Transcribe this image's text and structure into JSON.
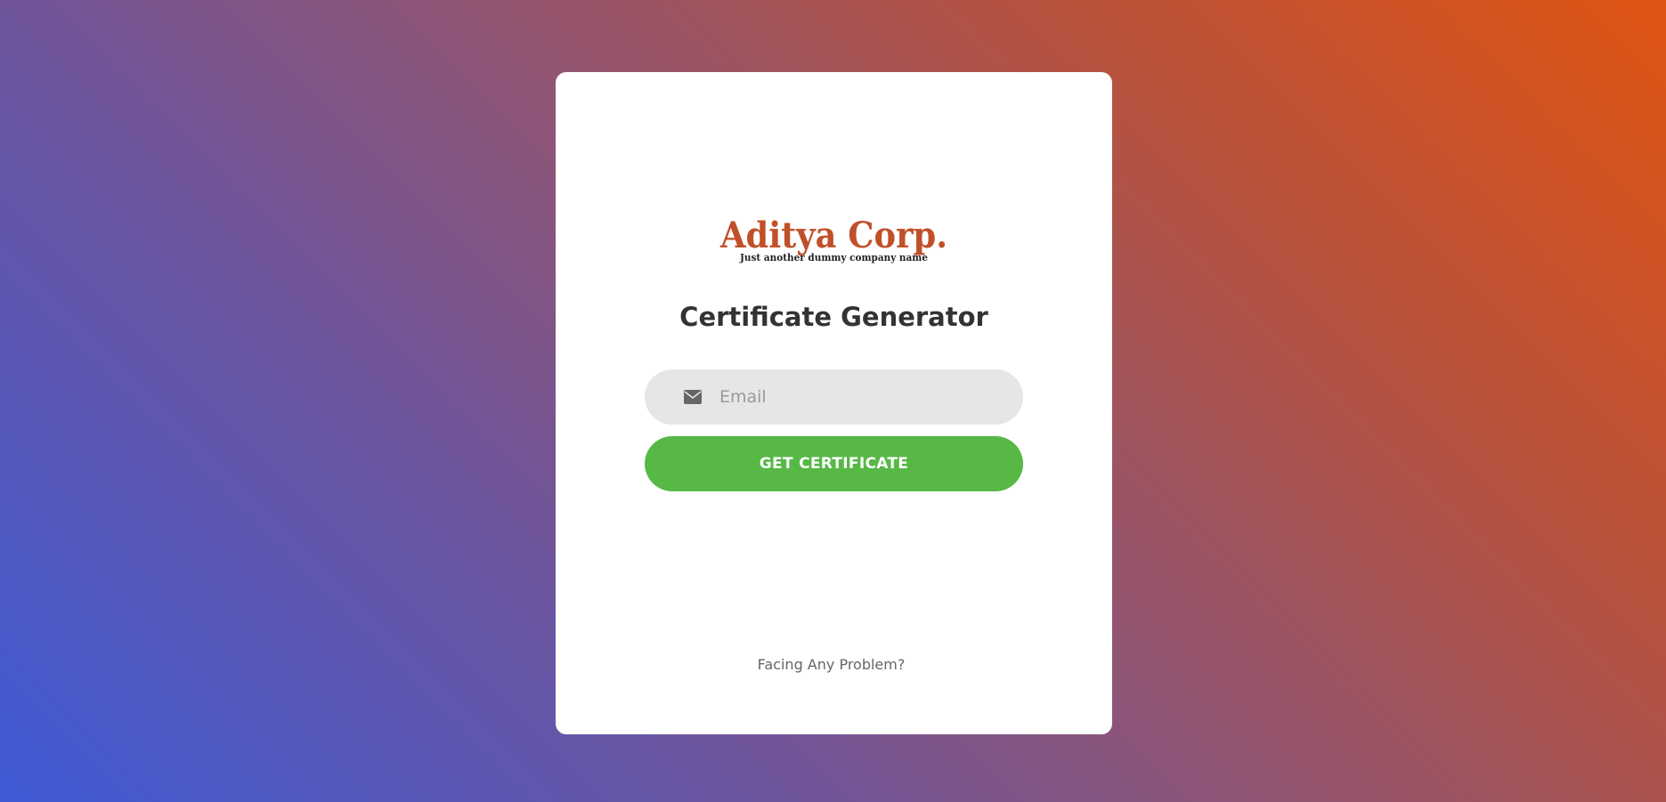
{
  "logo": {
    "name": "Aditya Corp.",
    "tagline": "Just another dummy company name"
  },
  "title": "Certificate Generator",
  "email": {
    "placeholder": "Email",
    "value": "",
    "icon": "envelope-icon"
  },
  "submit_label": "GET CERTIFICATE",
  "help_link": "Facing Any Problem?",
  "colors": {
    "brand": "#c0502a",
    "button": "#57b846",
    "input_bg": "#e6e6e6",
    "title": "#333333"
  }
}
